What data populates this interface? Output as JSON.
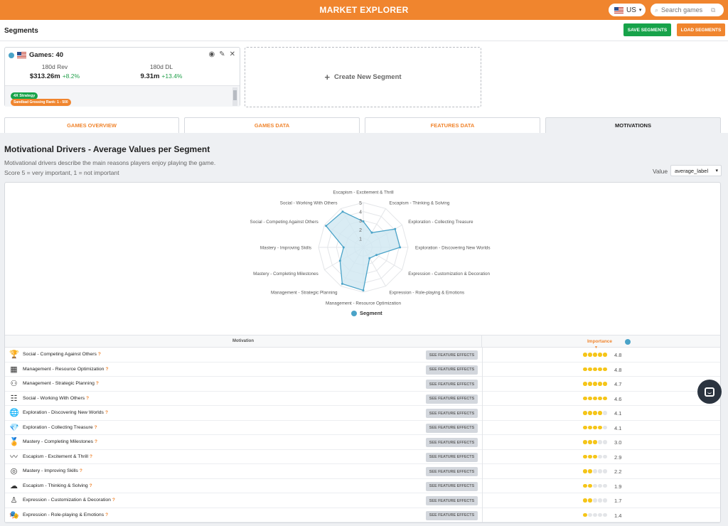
{
  "header": {
    "title": "MARKET EXPLORER",
    "country": "US",
    "search_placeholder": "Search games"
  },
  "segments_bar": {
    "title": "Segments",
    "save_label": "SAVE SEGMENTS",
    "load_label": "LOAD SEGMENTS"
  },
  "segment_card": {
    "title": "Games: 40",
    "rev_label": "180d Rev",
    "rev_value": "$313.26m",
    "rev_change": "+8.2%",
    "dl_label": "180d DL",
    "dl_value": "9.31m",
    "dl_change": "+13.4%",
    "filters": [
      "4X Strategy",
      "Sandbad Grossing Rank: 1 - 500"
    ]
  },
  "create_segment_label": "Create New Segment",
  "tabs": [
    {
      "label": "GAMES OVERVIEW"
    },
    {
      "label": "GAMES DATA"
    },
    {
      "label": "FEATURES DATA"
    },
    {
      "label": "MOTIVATIONS"
    }
  ],
  "section": {
    "title": "Motivational Drivers - Average Values per Segment",
    "desc1": "Motivational drivers describe the main reasons players enjoy playing the game.",
    "desc2": "Score 5 = very important, 1 = not important",
    "value_label": "Value",
    "value_selected": "average_label"
  },
  "chart_data": {
    "type": "radar",
    "axes": [
      "Escapism - Excitement & Thrill",
      "Escapism - Thinking & Solving",
      "Exploration - Collecting Treasure",
      "Exploration - Discovering New Worlds",
      "Expression - Customization & Decoration",
      "Expression - Role-playing & Emotions",
      "Management - Resource Optimization",
      "Management - Strategic Planning",
      "Mastery - Completing Milestones",
      "Mastery - Improving Skills",
      "Social - Competing Against Others",
      "Social - Working With Others"
    ],
    "ticks": [
      "1",
      "2",
      "3",
      "4",
      "5"
    ],
    "range": [
      0,
      5
    ],
    "series": [
      {
        "name": "Segment",
        "values": [
          2.9,
          1.9,
          4.1,
          4.1,
          1.7,
          1.4,
          4.8,
          4.7,
          3.0,
          2.2,
          4.8,
          4.6
        ]
      }
    ],
    "legend_position": "bottom",
    "colors": {
      "fill": "#cfe7f1",
      "stroke": "#4aa3c8"
    }
  },
  "table": {
    "col_motivation": "Motivation",
    "col_importance": "Importance",
    "fx_label": "SEE FEATURE EFFECTS",
    "rows": [
      {
        "icon": "trophy-icon",
        "glyph": "🏆",
        "name": "Social - Competing Against Others",
        "filled": 5,
        "score": "4.8"
      },
      {
        "icon": "pyramid-icon",
        "glyph": "▦",
        "name": "Management - Resource Optimization",
        "filled": 5,
        "score": "4.8"
      },
      {
        "icon": "strategy-icon",
        "glyph": "⚇",
        "name": "Management - Strategic Planning",
        "filled": 5,
        "score": "4.7"
      },
      {
        "icon": "team-icon",
        "glyph": "☷",
        "name": "Social - Working With Others",
        "filled": 5,
        "score": "4.6"
      },
      {
        "icon": "globe-icon",
        "glyph": "🌐",
        "name": "Exploration - Discovering New Worlds",
        "filled": 4,
        "score": "4.1"
      },
      {
        "icon": "diamond-icon",
        "glyph": "💎",
        "name": "Exploration - Collecting Treasure",
        "filled": 4,
        "score": "4.1"
      },
      {
        "icon": "medal-icon",
        "glyph": "🏅",
        "name": "Mastery - Completing Milestones",
        "filled": 3,
        "score": "3.0"
      },
      {
        "icon": "pulse-icon",
        "glyph": "〰",
        "name": "Escapism - Excitement & Thrill",
        "filled": 3,
        "score": "2.9"
      },
      {
        "icon": "target-icon",
        "glyph": "◎",
        "name": "Mastery - Improving Skills",
        "filled": 2,
        "score": "2.2"
      },
      {
        "icon": "brain-icon",
        "glyph": "☁",
        "name": "Escapism - Thinking & Solving",
        "filled": 2,
        "score": "1.9"
      },
      {
        "icon": "customize-icon",
        "glyph": "♙",
        "name": "Expression - Customization & Decoration",
        "filled": 2,
        "score": "1.7"
      },
      {
        "icon": "masks-icon",
        "glyph": "🎭",
        "name": "Expression - Role-playing & Emotions",
        "filled": 1,
        "score": "1.4"
      }
    ]
  },
  "colors": {
    "brand": "#f0852e",
    "save_green": "#17a34a",
    "dot_filled": "#f5c518",
    "dot_empty": "#e3e5e8"
  }
}
